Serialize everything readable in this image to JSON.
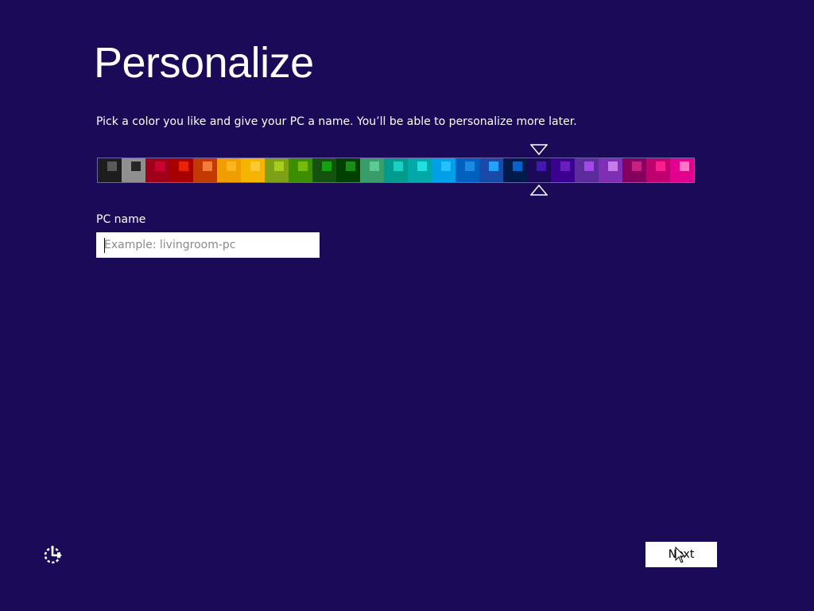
{
  "page": {
    "title": "Personalize",
    "subtitle": "Pick a color you like and give your PC a name. You’ll be able to personalize more later.",
    "background_color": "#1b0a58"
  },
  "color_picker": {
    "selected_index": 18,
    "swatches": [
      {
        "base": "#1d1d1d",
        "accent": "#5a5a5a"
      },
      {
        "base": "#8f8f8f",
        "accent": "#262626"
      },
      {
        "base": "#a1001b",
        "accent": "#cc0033"
      },
      {
        "base": "#a60000",
        "accent": "#ee2200"
      },
      {
        "base": "#c23a00",
        "accent": "#f47c3a"
      },
      {
        "base": "#f09d00",
        "accent": "#f9b520"
      },
      {
        "base": "#f5b400",
        "accent": "#ffc837"
      },
      {
        "base": "#7e9f16",
        "accent": "#a4cf1d"
      },
      {
        "base": "#3c8d00",
        "accent": "#78bb07"
      },
      {
        "base": "#15520e",
        "accent": "#12a30f"
      },
      {
        "base": "#004000",
        "accent": "#198e14"
      },
      {
        "base": "#399c6b",
        "accent": "#5fc996"
      },
      {
        "base": "#009a8f",
        "accent": "#18d1c4"
      },
      {
        "base": "#00a8a8",
        "accent": "#22e0e0"
      },
      {
        "base": "#00a0e8",
        "accent": "#27c0ff"
      },
      {
        "base": "#0060c0",
        "accent": "#1b8be0"
      },
      {
        "base": "#1a4aa8",
        "accent": "#1fa3ff"
      },
      {
        "base": "#001a4a",
        "accent": "#0064d0"
      },
      {
        "base": "#1b0a58",
        "accent": "#4417b4"
      },
      {
        "base": "#3a0090",
        "accent": "#6a1ec0"
      },
      {
        "base": "#5c2c9c",
        "accent": "#a14ae8"
      },
      {
        "base": "#7e2fb4",
        "accent": "#c67de8"
      },
      {
        "base": "#86005f",
        "accent": "#c72080"
      },
      {
        "base": "#c0006e",
        "accent": "#ff1d8e"
      },
      {
        "base": "#e4008e",
        "accent": "#ff76c8"
      }
    ]
  },
  "pc_name": {
    "label": "PC name",
    "placeholder": "Example: livingroom-pc",
    "value": ""
  },
  "footer": {
    "ease_of_access_icon": "ease-of-access-icon",
    "next_label": "Next"
  }
}
